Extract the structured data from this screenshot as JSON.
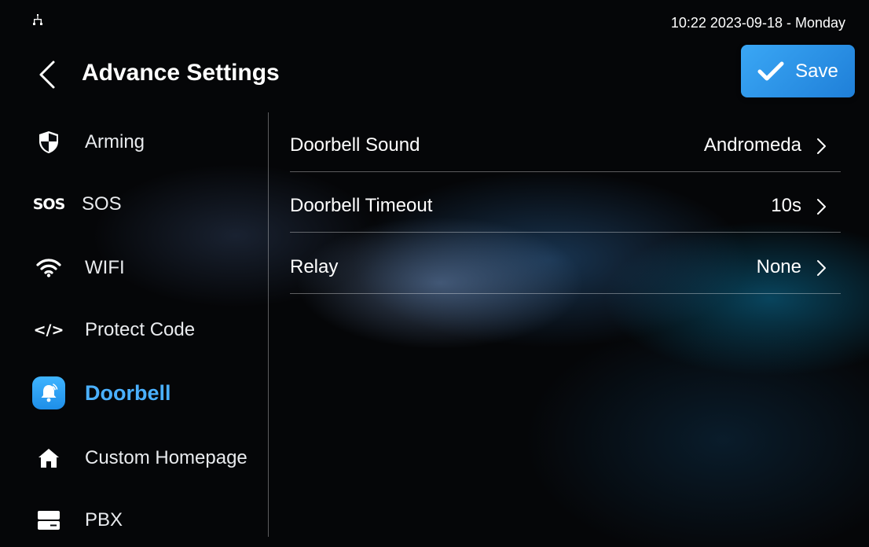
{
  "status_bar": {
    "network_icon": "ethernet-icon",
    "datetime": "10:22  2023-09-18 - Monday"
  },
  "header": {
    "title": "Advance Settings",
    "save_label": "Save"
  },
  "sidebar": {
    "items": [
      {
        "label": "Arming",
        "icon": "shield-icon",
        "active": false
      },
      {
        "label": "SOS",
        "icon": "sos-icon",
        "icon_text": "SOS",
        "active": false
      },
      {
        "label": "WIFI",
        "icon": "wifi-icon",
        "active": false
      },
      {
        "label": "Protect Code",
        "icon": "code-icon",
        "icon_text": "</>",
        "active": false
      },
      {
        "label": "Doorbell",
        "icon": "bell-icon",
        "active": true
      },
      {
        "label": "Custom Homepage",
        "icon": "home-icon",
        "active": false
      },
      {
        "label": "PBX",
        "icon": "server-icon",
        "active": false
      }
    ]
  },
  "settings": {
    "rows": [
      {
        "label": "Doorbell Sound",
        "value": "Andromeda"
      },
      {
        "label": "Doorbell Timeout",
        "value": "10s"
      },
      {
        "label": "Relay",
        "value": "None"
      }
    ]
  },
  "colors": {
    "accent": "#3aa7f5",
    "active_text": "#4ab0ff",
    "background": "#050608"
  }
}
